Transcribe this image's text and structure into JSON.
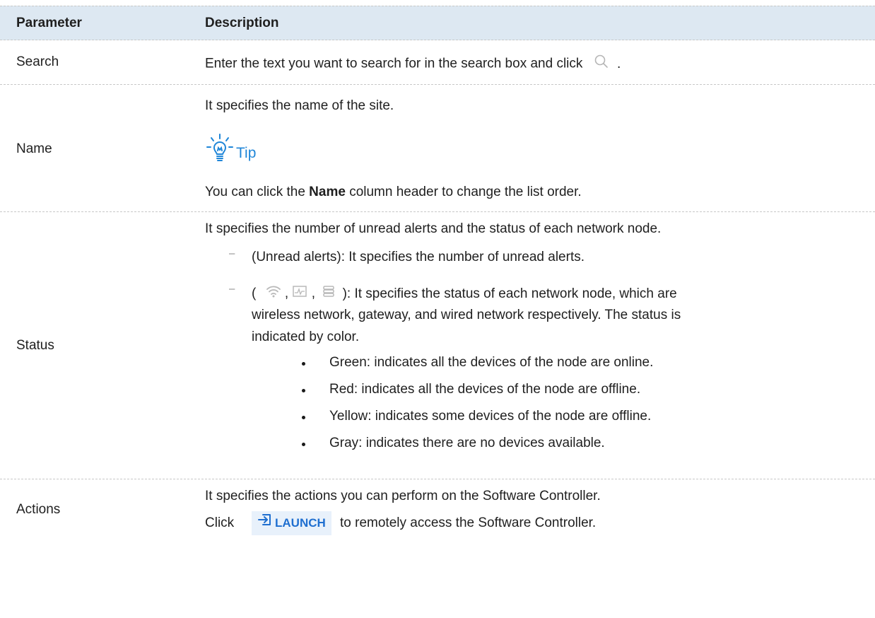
{
  "header": {
    "col1": "Parameter",
    "col2": "Description"
  },
  "rows": {
    "search": {
      "param": "Search",
      "desc_prefix": "Enter the text you want to search for in the search box and click",
      "desc_suffix": "."
    },
    "name": {
      "param": "Name",
      "desc": "It specifies the name of the site.",
      "tip_label": "Tip",
      "tip_prefix": "You can click the",
      "tip_bold": "Name",
      "tip_suffix": "column header to change the list order."
    },
    "status": {
      "param": "Status",
      "desc": "It specifies the number of unread alerts and the status of each network node.",
      "item1": "(Unread alerts): It specifies the number of unread alerts.",
      "item2_open": "(",
      "item2_sep1": ",",
      "item2_sep2": ",",
      "item2_line1": "): It specifies the status of each network node, which are",
      "item2_line2": "wireless network, gateway, and wired network respectively. The status is",
      "item2_line3": "indicated by color.",
      "bullets": [
        "Green: indicates all the devices of the node are online.",
        "Red: indicates all the devices of the node are offline.",
        "Yellow: indicates some devices of the node are offline.",
        "Gray: indicates there are no devices available."
      ]
    },
    "actions": {
      "param": "Actions",
      "desc": "It specifies the actions you can perform on the Software Controller.",
      "click_prefix": "Click",
      "launch_label": "LAUNCH",
      "click_suffix": "to remotely access the Software Controller."
    }
  },
  "icons": {
    "search": "search-icon",
    "tip": "lightbulb-icon",
    "wifi": "wifi-icon",
    "gateway": "gateway-icon",
    "wired": "wired-network-icon",
    "launch": "launch-arrow-icon"
  },
  "colors": {
    "header_bg": "#dde8f2",
    "tip": "#1f86d8",
    "launch_text": "#1f6fd0",
    "launch_bg": "#e8f1fb"
  }
}
